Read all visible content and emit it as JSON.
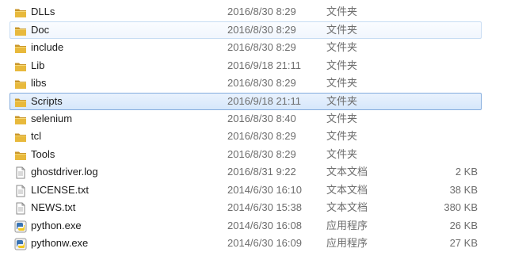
{
  "files": [
    {
      "name": "DLLs",
      "date": "2016/8/30 8:29",
      "type": "文件夹",
      "size": "",
      "icon": "folder-icon",
      "state": "normal"
    },
    {
      "name": "Doc",
      "date": "2016/8/30 8:29",
      "type": "文件夹",
      "size": "",
      "icon": "folder-icon",
      "state": "hover"
    },
    {
      "name": "include",
      "date": "2016/8/30 8:29",
      "type": "文件夹",
      "size": "",
      "icon": "folder-icon",
      "state": "normal"
    },
    {
      "name": "Lib",
      "date": "2016/9/18 21:11",
      "type": "文件夹",
      "size": "",
      "icon": "folder-icon",
      "state": "normal"
    },
    {
      "name": "libs",
      "date": "2016/8/30 8:29",
      "type": "文件夹",
      "size": "",
      "icon": "folder-icon",
      "state": "normal"
    },
    {
      "name": "Scripts",
      "date": "2016/9/18 21:11",
      "type": "文件夹",
      "size": "",
      "icon": "folder-icon",
      "state": "selected"
    },
    {
      "name": "selenium",
      "date": "2016/8/30 8:40",
      "type": "文件夹",
      "size": "",
      "icon": "folder-icon",
      "state": "normal"
    },
    {
      "name": "tcl",
      "date": "2016/8/30 8:29",
      "type": "文件夹",
      "size": "",
      "icon": "folder-icon",
      "state": "normal"
    },
    {
      "name": "Tools",
      "date": "2016/8/30 8:29",
      "type": "文件夹",
      "size": "",
      "icon": "folder-icon",
      "state": "normal"
    },
    {
      "name": "ghostdriver.log",
      "date": "2016/8/31 9:22",
      "type": "文本文档",
      "size": "2 KB",
      "icon": "text-file-icon",
      "state": "normal"
    },
    {
      "name": "LICENSE.txt",
      "date": "2014/6/30 16:10",
      "type": "文本文档",
      "size": "38 KB",
      "icon": "text-file-icon",
      "state": "normal"
    },
    {
      "name": "NEWS.txt",
      "date": "2014/6/30 15:38",
      "type": "文本文档",
      "size": "380 KB",
      "icon": "text-file-icon",
      "state": "normal"
    },
    {
      "name": "python.exe",
      "date": "2014/6/30 16:08",
      "type": "应用程序",
      "size": "26 KB",
      "icon": "python-exe-icon",
      "state": "normal"
    },
    {
      "name": "pythonw.exe",
      "date": "2014/6/30 16:09",
      "type": "应用程序",
      "size": "27 KB",
      "icon": "python-exe-icon",
      "state": "normal"
    }
  ],
  "colors": {
    "folder": "#e8b93c",
    "folder_dark": "#c9962a",
    "selection_border": "#84acdd",
    "hover_border": "#c7dcf3",
    "meta_text": "#6d6d6d"
  }
}
